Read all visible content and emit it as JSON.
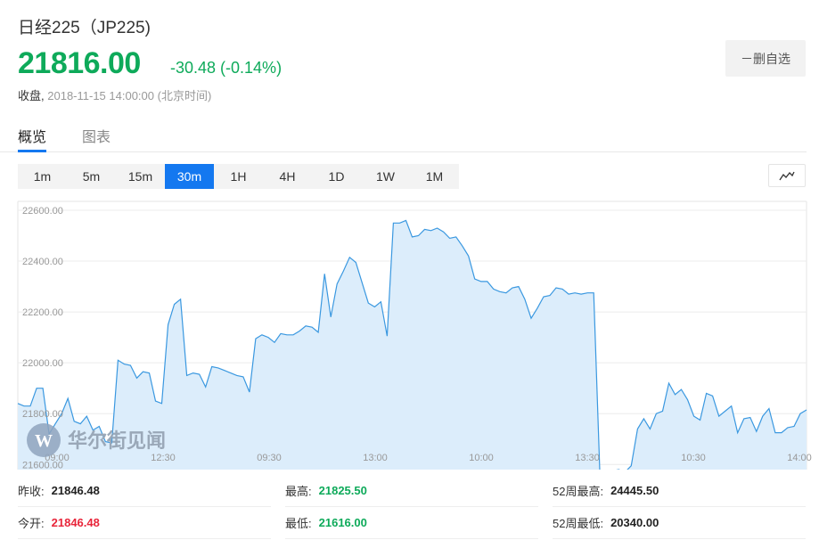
{
  "header": {
    "title": "日经225（JP225)",
    "price": "21816.00",
    "change": "-30.48 (-0.14%)",
    "close_label": "收盘,",
    "timestamp": "2018-11-15 14:00:00 (北京时间)",
    "remove_watchlist_label": "－删自选"
  },
  "tabs": [
    {
      "label": "概览",
      "active": true
    },
    {
      "label": "图表",
      "active": false
    }
  ],
  "periods": [
    {
      "label": "1m"
    },
    {
      "label": "5m"
    },
    {
      "label": "15m"
    },
    {
      "label": "30m",
      "active": true
    },
    {
      "label": "1H"
    },
    {
      "label": "4H"
    },
    {
      "label": "1D"
    },
    {
      "label": "1W"
    },
    {
      "label": "1M"
    }
  ],
  "chart_type_icon": "line-chart-icon",
  "watermark": "华尔街见闻",
  "colors": {
    "up_green": "#0eaa5a",
    "down_red": "#e8253a",
    "accent_blue": "#1478f0",
    "line": "#3a98e0",
    "area": "#dcedfb"
  },
  "chart_data": {
    "type": "area",
    "xlabel": "",
    "ylabel": "",
    "y_ticks": [
      "22600.00",
      "22400.00",
      "22200.00",
      "22000.00",
      "21800.00",
      "21600.00"
    ],
    "ylim": [
      21580,
      22635
    ],
    "x_ticks": [
      "09:00",
      "12:30",
      "09:30",
      "13:00",
      "10:00",
      "13:30",
      "10:30",
      "14:00"
    ],
    "grid": true,
    "values": [
      21840,
      21830,
      21830,
      21900,
      21900,
      21720,
      21760,
      21800,
      21860,
      21770,
      21760,
      21790,
      21735,
      21750,
      21690,
      21685,
      22010,
      21995,
      21990,
      21940,
      21965,
      21960,
      21850,
      21840,
      22150,
      22230,
      22250,
      21950,
      21960,
      21955,
      21905,
      21985,
      21980,
      21970,
      21960,
      21950,
      21945,
      21885,
      22095,
      22110,
      22100,
      22080,
      22115,
      22110,
      22110,
      22125,
      22145,
      22140,
      22120,
      22350,
      22180,
      22310,
      22360,
      22415,
      22395,
      22315,
      22235,
      22220,
      22240,
      22105,
      22550,
      22550,
      22560,
      22495,
      22500,
      22525,
      22520,
      22530,
      22515,
      22490,
      22495,
      22460,
      22420,
      22330,
      22320,
      22320,
      22290,
      22280,
      22275,
      22295,
      22300,
      22250,
      22175,
      22215,
      22260,
      22265,
      22295,
      22290,
      22270,
      22275,
      22270,
      22275,
      22275,
      21555,
      21565,
      21575,
      21580,
      21570,
      21595,
      21740,
      21780,
      21740,
      21800,
      21810,
      21920,
      21875,
      21895,
      21855,
      21790,
      21775,
      21880,
      21870,
      21790,
      21810,
      21830,
      21725,
      21780,
      21785,
      21730,
      21790,
      21820,
      21725,
      21725,
      21745,
      21750,
      21800,
      21815
    ]
  },
  "stats": [
    {
      "label": "昨收:",
      "value": "21846.48",
      "color": "default"
    },
    {
      "label": "最高:",
      "value": "21825.50",
      "color": "green"
    },
    {
      "label": "52周最高:",
      "value": "24445.50",
      "color": "default"
    },
    {
      "label": "今开:",
      "value": "21846.48",
      "color": "red"
    },
    {
      "label": "最低:",
      "value": "21616.00",
      "color": "green"
    },
    {
      "label": "52周最低:",
      "value": "20340.00",
      "color": "default"
    }
  ]
}
